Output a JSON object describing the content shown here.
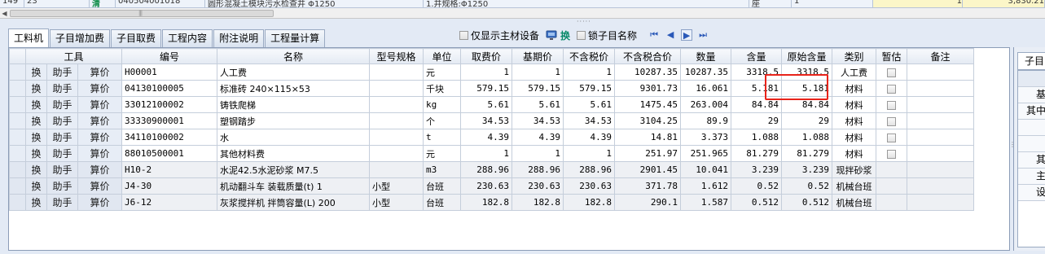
{
  "top_row": {
    "row_no": "149",
    "col2": "23",
    "type_glyph": "清",
    "code": "040504001018",
    "name": "圆形混凝土模块污水检查井 Φ1250",
    "spec": "1.井规格:Φ1250",
    "unit": "座",
    "qty": "1",
    "val1": "1",
    "val2": "3,830.21"
  },
  "tabs": [
    "工料机",
    "子目增加费",
    "子目取费",
    "工程内容",
    "附注说明",
    "工程量计算"
  ],
  "active_tab": 0,
  "toolbar": {
    "show_main_material": "仅显示主材设备",
    "swap_label": "换",
    "lock_name": "锁子目名称",
    "nav_first": "⏮",
    "nav_prev": "◀",
    "nav_next": "▶",
    "nav_last": "⏭"
  },
  "columns": [
    "工具",
    "编号",
    "名称",
    "型号规格",
    "单位",
    "取费价",
    "基期价",
    "不含税价",
    "不含税合价",
    "数量",
    "含量",
    "原始含量",
    "类别",
    "暂估",
    "备注"
  ],
  "tool_buttons": [
    "换",
    "助手",
    "算价"
  ],
  "rows": [
    {
      "code": "H00001",
      "name": "人工费",
      "spec": "",
      "unit": "元",
      "fee_price": "1",
      "base_price": "1",
      "notax_price": "1",
      "notax_total": "10287.35",
      "qty": "10287.35",
      "content": "3318.5",
      "orig_content": "3318.5",
      "category": "人工费",
      "estimate": false,
      "remark": "",
      "gray": false
    },
    {
      "code": "04130100005",
      "name": "标准砖 240×115×53",
      "spec": "",
      "unit": "千块",
      "fee_price": "579.15",
      "base_price": "579.15",
      "notax_price": "579.15",
      "notax_total": "9301.73",
      "qty": "16.061",
      "content": "5.181",
      "orig_content": "5.181",
      "category": "材料",
      "estimate": true,
      "remark": "",
      "gray": false
    },
    {
      "code": "33012100002",
      "name": "铸铁爬梯",
      "spec": "",
      "unit": "kg",
      "fee_price": "5.61",
      "base_price": "5.61",
      "notax_price": "5.61",
      "notax_total": "1475.45",
      "qty": "263.004",
      "content": "84.84",
      "orig_content": "84.84",
      "category": "材料",
      "estimate": true,
      "remark": "",
      "gray": false
    },
    {
      "code": "33330900001",
      "name": "塑钢踏步",
      "spec": "",
      "unit": "个",
      "fee_price": "34.53",
      "base_price": "34.53",
      "notax_price": "34.53",
      "notax_total": "3104.25",
      "qty": "89.9",
      "content": "29",
      "orig_content": "29",
      "category": "材料",
      "estimate": true,
      "remark": "",
      "gray": false
    },
    {
      "code": "34110100002",
      "name": "水",
      "spec": "",
      "unit": "t",
      "fee_price": "4.39",
      "base_price": "4.39",
      "notax_price": "4.39",
      "notax_total": "14.81",
      "qty": "3.373",
      "content": "1.088",
      "orig_content": "1.088",
      "category": "材料",
      "estimate": true,
      "remark": "",
      "gray": false
    },
    {
      "code": "88010500001",
      "name": "其他材料费",
      "spec": "",
      "unit": "元",
      "fee_price": "1",
      "base_price": "1",
      "notax_price": "1",
      "notax_total": "251.97",
      "qty": "251.965",
      "content": "81.279",
      "orig_content": "81.279",
      "category": "材料",
      "estimate": true,
      "remark": "",
      "gray": false
    },
    {
      "code": "H10-2",
      "name": "水泥42.5水泥砂浆 M7.5",
      "spec": "",
      "unit": "m3",
      "fee_price": "288.96",
      "base_price": "288.96",
      "notax_price": "288.96",
      "notax_total": "2901.45",
      "qty": "10.041",
      "content": "3.239",
      "orig_content": "3.239",
      "category": "现拌砂浆",
      "estimate": null,
      "remark": "",
      "gray": true
    },
    {
      "code": "J4-30",
      "name": "机动翻斗车 装载质量(t) 1",
      "spec": "小型",
      "unit": "台班",
      "fee_price": "230.63",
      "base_price": "230.63",
      "notax_price": "230.63",
      "notax_total": "371.78",
      "qty": "1.612",
      "content": "0.52",
      "orig_content": "0.52",
      "category": "机械台班",
      "estimate": null,
      "remark": "",
      "gray": true
    },
    {
      "code": "J6-12",
      "name": "灰浆搅拌机 拌筒容量(L) 200",
      "spec": "小型",
      "unit": "台班",
      "fee_price": "182.8",
      "base_price": "182.8",
      "notax_price": "182.8",
      "notax_total": "290.1",
      "qty": "1.587",
      "content": "0.512",
      "orig_content": "0.512",
      "category": "机械台班",
      "estimate": null,
      "remark": "",
      "gray": true
    }
  ],
  "right_panel": {
    "tab_label": "子目",
    "rows": [
      "",
      "基",
      "其中",
      "",
      "",
      "其",
      "主",
      "设"
    ]
  },
  "colors": {
    "highlight_box": "#e8231a",
    "accent": "#2b59b8"
  }
}
